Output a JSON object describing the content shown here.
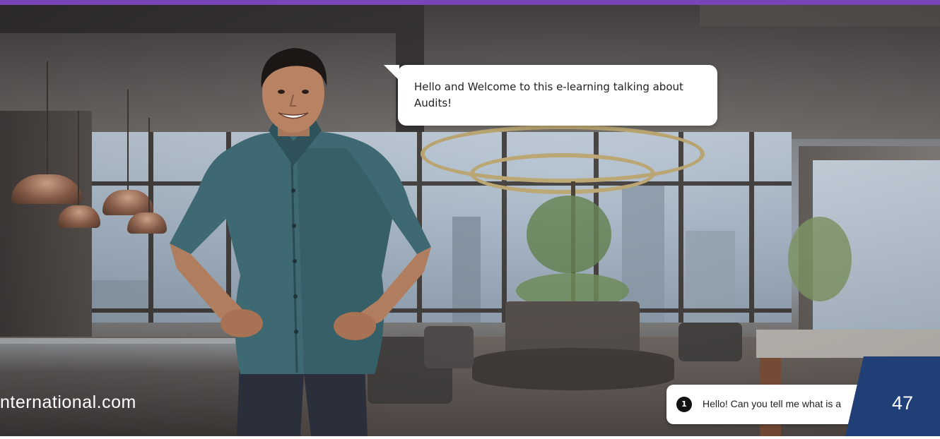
{
  "colors": {
    "top_bar": "#7a43b6",
    "page_badge": "#1f3f76",
    "speech_bg": "#ffffff",
    "choice_number_bg": "#111111"
  },
  "speech_bubble": {
    "text": "Hello and Welcome to this e-learning talking about Audits!"
  },
  "watermark": {
    "text": "nternational.com"
  },
  "choice": {
    "number": "1",
    "text": "Hello! Can you tell me what is a"
  },
  "page": {
    "number": "47"
  },
  "character": {
    "icon": "character-icon"
  }
}
